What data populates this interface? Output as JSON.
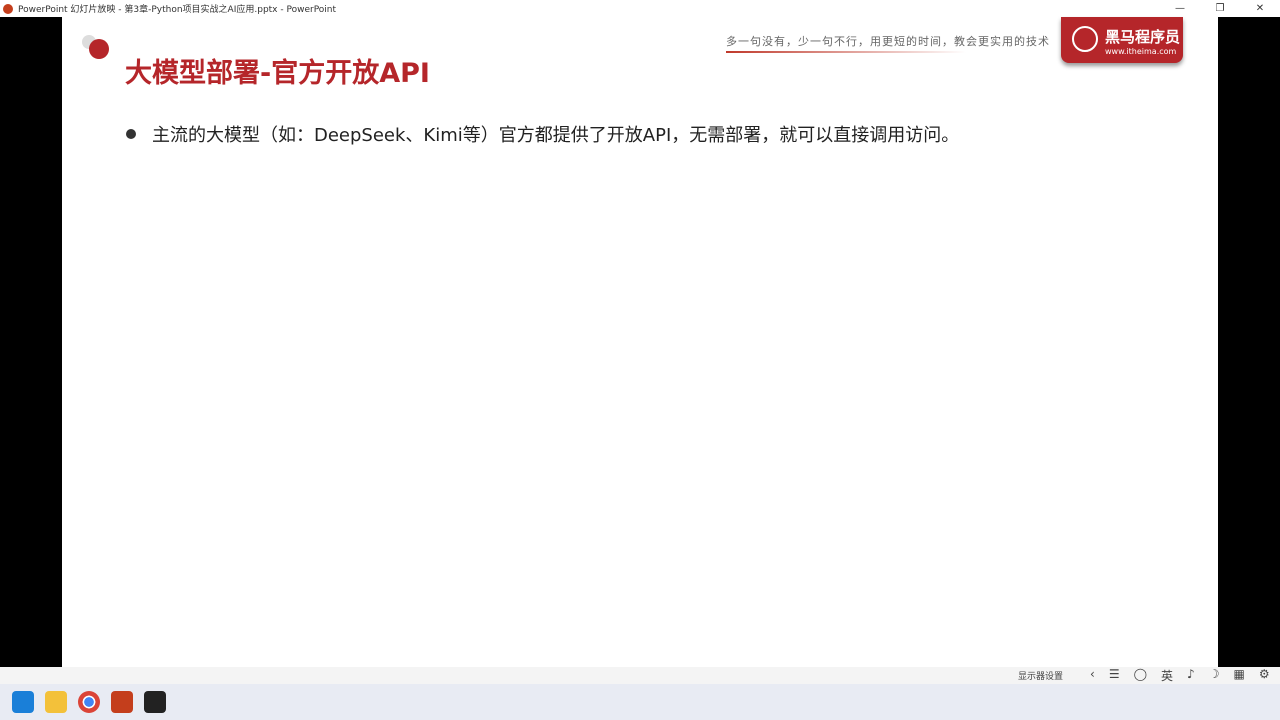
{
  "window": {
    "title": "PowerPoint 幻灯片放映  -  第3章-Python项目实战之AI应用.pptx - PowerPoint",
    "minimize": "—",
    "restore": "❐",
    "close": "✕"
  },
  "slide": {
    "title": "大模型部署-官方开放API",
    "motto": "多一句没有，少一句不行，用更短的时间，教会更实用的技术",
    "brand_name": "黑马程序员",
    "brand_url": "www.itheima.com",
    "bullets": [
      "主流的大模型（如：DeepSeek、Kimi等）官方都提供了开放API，无需部署，就可以直接调用访问。"
    ]
  },
  "controls": {
    "display_settings": "显示器设置",
    "prev": "‹",
    "icons": [
      "☰",
      "◯",
      "英",
      "♪",
      "☽",
      "▦",
      "⚙"
    ]
  },
  "taskbar": {
    "apps": [
      "windows-start",
      "file-explorer",
      "chrome",
      "powerpoint",
      "terminal"
    ]
  }
}
